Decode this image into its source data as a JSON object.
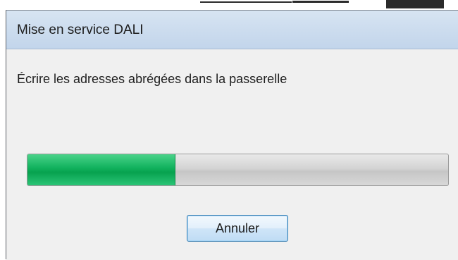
{
  "dialog": {
    "title": "Mise en service DALI",
    "message": "Écrire les adresses abrégées dans la passerelle",
    "progress": 0.35,
    "cancel_label": "Annuler"
  },
  "colors": {
    "progress_fill": "#13b35f",
    "title_bar": "#c9dbee",
    "button_border": "#3c7fb1"
  }
}
